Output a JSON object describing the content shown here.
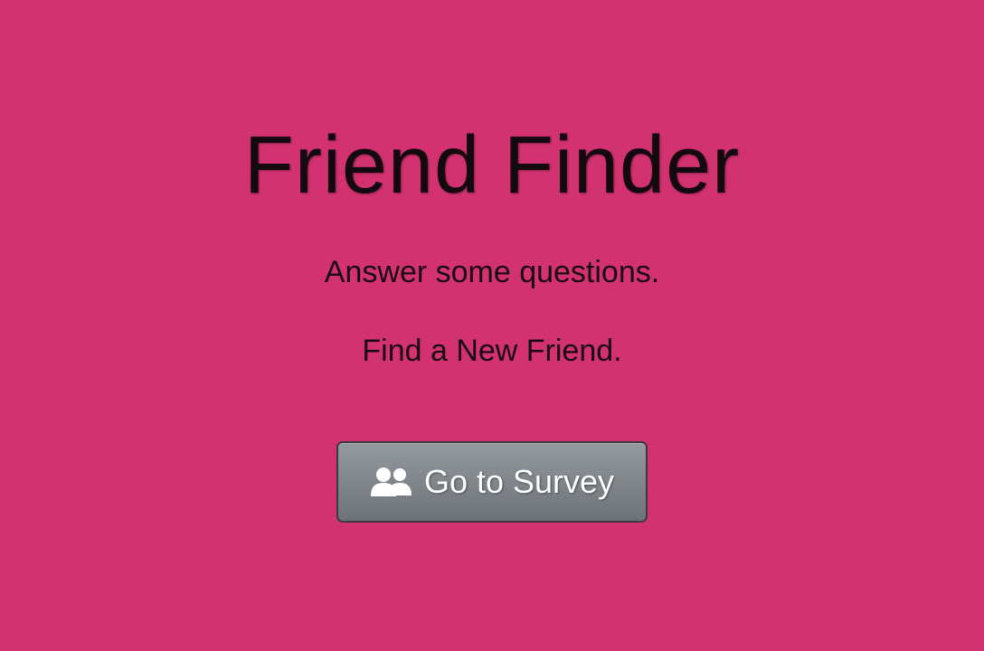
{
  "hero": {
    "title": "Friend Finder",
    "line1": "Answer some questions.",
    "line2": "Find a New Friend."
  },
  "survey_button": {
    "label": "Go to Survey",
    "icon": "users-icon"
  },
  "colors": {
    "background": "#d33270",
    "text": "#1a0a12",
    "button": "#7c8287",
    "button_text": "#ffffff"
  }
}
